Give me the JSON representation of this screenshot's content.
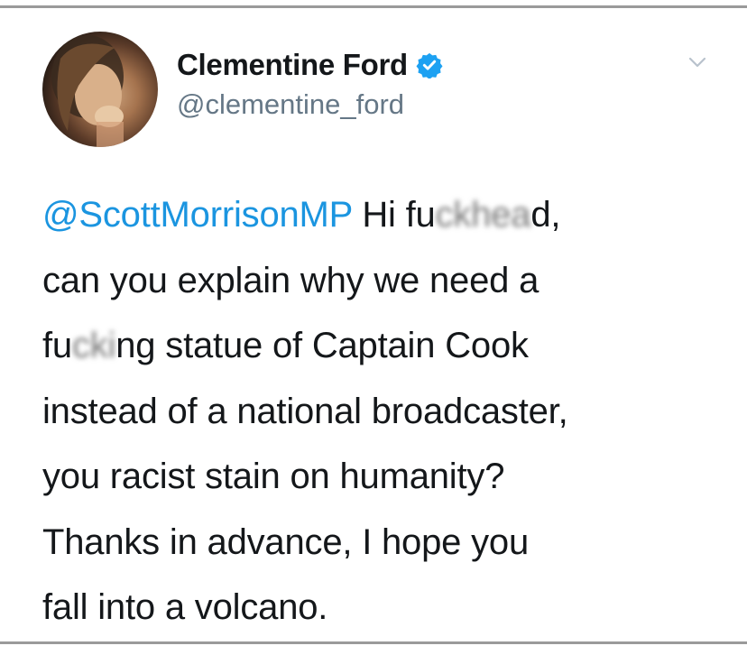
{
  "author": {
    "display_name": "Clementine Ford",
    "handle": "@clementine_ford",
    "verified": true,
    "avatar_icon": "profile-photo",
    "verified_color": "#1da1f2"
  },
  "menu": {
    "icon": "chevron-down-icon"
  },
  "tweet": {
    "mention": "@ScottMorrisonMP",
    "line1_prefix": " Hi fu",
    "line1_censored": "ckhea",
    "line1_suffix": "d,",
    "line2": "can you explain why we need a",
    "line3_prefix": "fu",
    "line3_censored": "cki",
    "line3_suffix": "ng statue of Captain Cook",
    "line4": "instead of a national broadcaster,",
    "line5": "you racist stain on humanity?",
    "line6": "Thanks in advance, I hope you",
    "line7": "fall into a volcano."
  },
  "colors": {
    "mention": "#1b95e0",
    "text": "#14171a",
    "secondary": "#657786"
  }
}
